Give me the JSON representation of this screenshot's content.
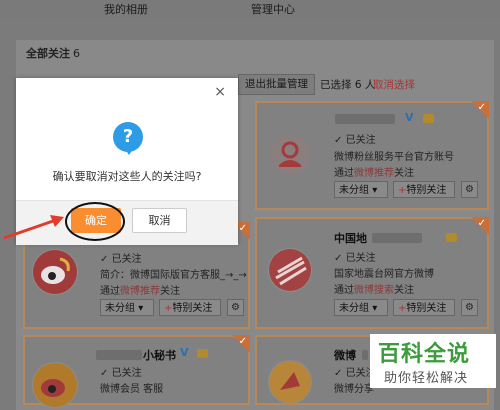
{
  "topnav": {
    "album": "我的相册",
    "manage": "管理中心"
  },
  "panel": {
    "title": "全部关注",
    "count": "6"
  },
  "toolbar": {
    "exit_batch": "退出批量管理",
    "selected": "已选择 6 人",
    "cancel_select": "取消选择"
  },
  "dialog": {
    "close": "×",
    "icon": "question-icon",
    "message": "确认要取消对这些人的关注吗?",
    "ok": "确定",
    "cancel": "取消"
  },
  "cards": [
    {
      "followed": "已关注",
      "desc": "微博粉丝服务平台官方账号",
      "via_prefix": "通过",
      "via": "微博推荐",
      "via_suffix": "关注",
      "group": "未分组",
      "special": "特别关注",
      "verified": "V"
    },
    {
      "name_suffix": "中国地",
      "followed": "已关注",
      "desc": "国家地震台网官方微博",
      "via_prefix": "通过",
      "via": "微博搜索",
      "via_suffix": "关注",
      "group": "未分组",
      "special": "特别关注"
    },
    {
      "followed": "已关注",
      "desc": "简介：微博国际版官方客服_→_→",
      "via_prefix": "通过",
      "via": "微博推荐",
      "via_suffix": "关注",
      "group": "未分组",
      "special": "特别关注"
    },
    {
      "name_suffix": "小秘书",
      "verified": "V",
      "followed": "已关注",
      "desc": "微博会员 客服"
    },
    {
      "name_suffix": "微博",
      "followed": "已关注",
      "desc": "微博分享"
    }
  ],
  "card_icons": {
    "check": "✓",
    "plus": "+",
    "gear": "⚙",
    "dropdown": "▾"
  },
  "watermark": {
    "big": "百科全说",
    "small": "助你轻松解决"
  },
  "colors": {
    "accent": "#f98d2f",
    "link": "#2e9be6",
    "watermark": "#3c9c3c"
  }
}
